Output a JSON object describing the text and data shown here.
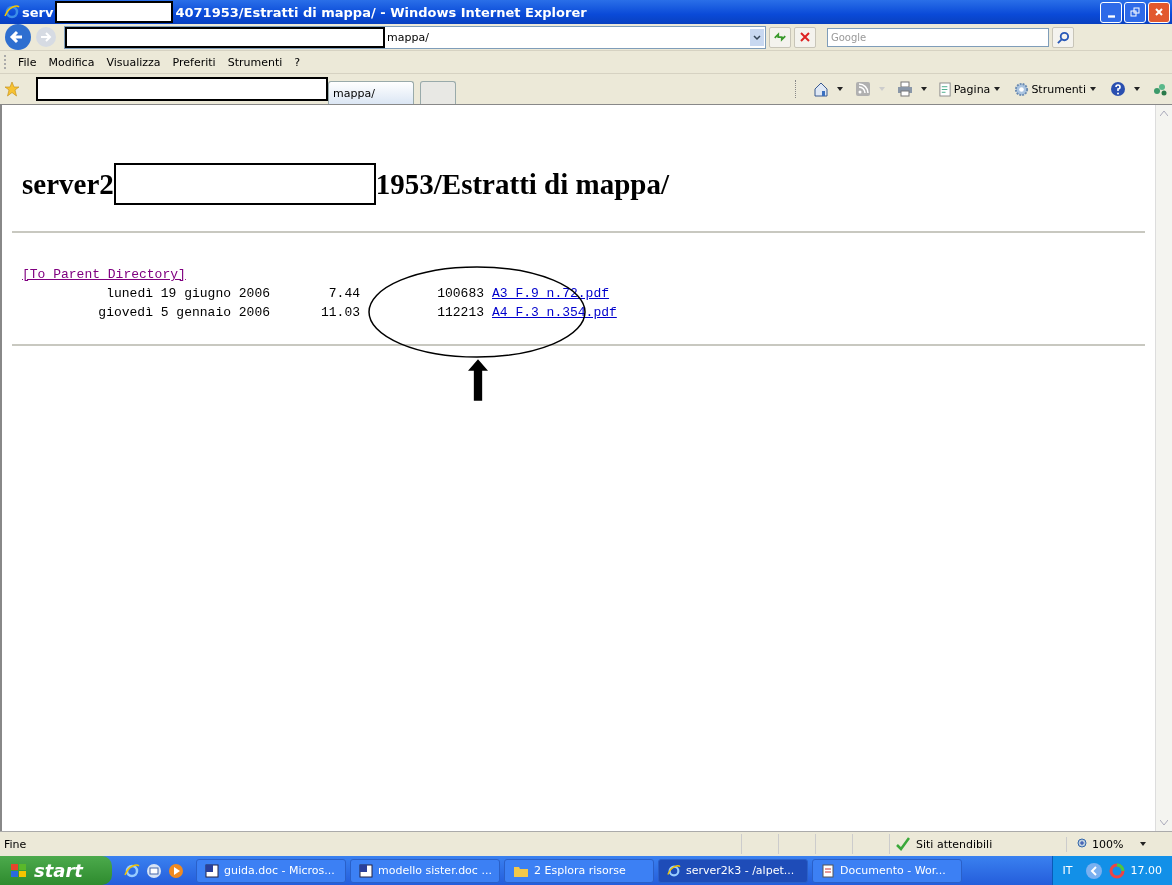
{
  "window": {
    "title_start": "serv",
    "title_end": "4071953/Estratti di mappa/ - Windows Internet Explorer"
  },
  "address_bar": {
    "url_tail": "mappa/",
    "search_placeholder": "Google"
  },
  "menu": [
    "File",
    "Modifica",
    "Visualizza",
    "Preferiti",
    "Strumenti",
    "?"
  ],
  "tabs": [
    {
      "label": "mappa/",
      "selected": true
    },
    {
      "selected": false
    }
  ],
  "command_bar": {
    "page_label": "Pagina",
    "tools_label": "Strumenti"
  },
  "page": {
    "heading_start": "server2",
    "heading_end": "1953/Estratti di mappa/",
    "parent_link": "[To Parent Directory]",
    "files": [
      {
        "date": "lunedì 19 giugno 2006",
        "time": "7.44",
        "size": "100683",
        "name": "A3 F.9 n.72.pdf"
      },
      {
        "date": "giovedì 5 gennaio 2006",
        "time": "11.03",
        "size": "112213",
        "name": "A4 F.3 n.354.pdf"
      }
    ]
  },
  "status_bar": {
    "text": "Fine",
    "zone": "Siti attendibili",
    "zoom": "100%"
  },
  "taskbar": {
    "start": "start",
    "tasks": [
      {
        "label": "guida.doc - Micros...",
        "kind": "word",
        "selected": false
      },
      {
        "label": "modello sister.doc ...",
        "kind": "word",
        "selected": false
      },
      {
        "label": "2 Esplora risorse",
        "kind": "folder",
        "selected": false
      },
      {
        "label": "server2k3 - /alpet...",
        "kind": "ie",
        "selected": true
      },
      {
        "label": "Documento - Wor...",
        "kind": "doc",
        "selected": false
      }
    ],
    "language": "IT",
    "clock": "17.00"
  }
}
